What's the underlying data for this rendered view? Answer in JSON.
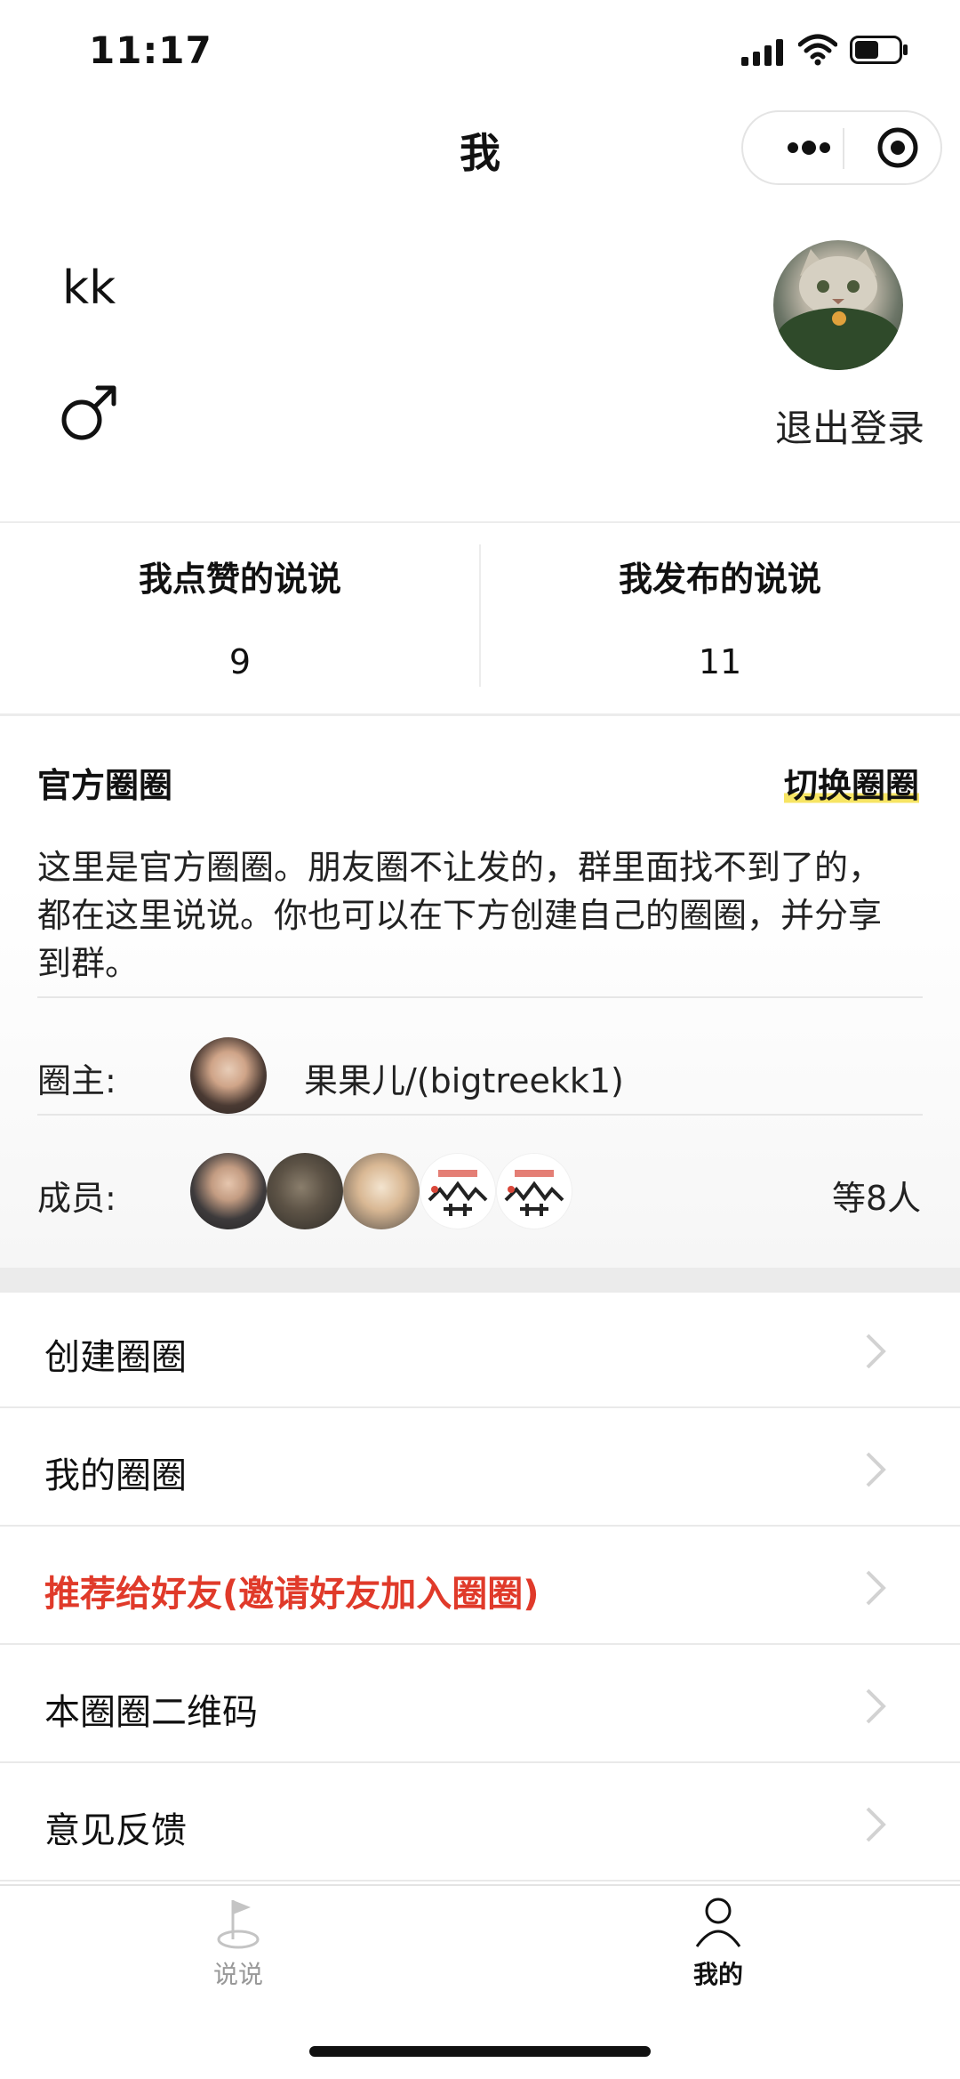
{
  "status_bar": {
    "time": "11:17"
  },
  "nav": {
    "title": "我"
  },
  "profile": {
    "username": "kk",
    "logout_label": "退出登录"
  },
  "stats": [
    {
      "title": "我点赞的说说",
      "value": "9"
    },
    {
      "title": "我发布的说说",
      "value": "11"
    }
  ],
  "circle": {
    "name": "官方圈圈",
    "switch_label": "切换圈圈",
    "description_lines": [
      "这里是官方圈圈。朋友圈不让发的，群里面找不到了的，",
      "都在这里说说。你也可以在下方创建自己的圈圈，并分享",
      "到群。"
    ],
    "owner_label": "圈主:",
    "owner_name": "果果儿/(bigtreekk1)",
    "members_label": "成员:",
    "members_count": "等8人"
  },
  "menu": [
    {
      "label": "创建圈圈"
    },
    {
      "label": "我的圈圈"
    },
    {
      "label": "推荐给好友(邀请好友加入圈圈)"
    },
    {
      "label": "本圈圈二维码"
    },
    {
      "label": "意见反馈"
    }
  ],
  "tabbar": [
    {
      "label": "说说",
      "icon": "flag-icon",
      "active": false
    },
    {
      "label": "我的",
      "icon": "person-icon",
      "active": true
    }
  ],
  "colors": {
    "accent_red": "#e03a2a",
    "highlight_yellow": "#f7e564",
    "inactive_tab": "#999999"
  }
}
